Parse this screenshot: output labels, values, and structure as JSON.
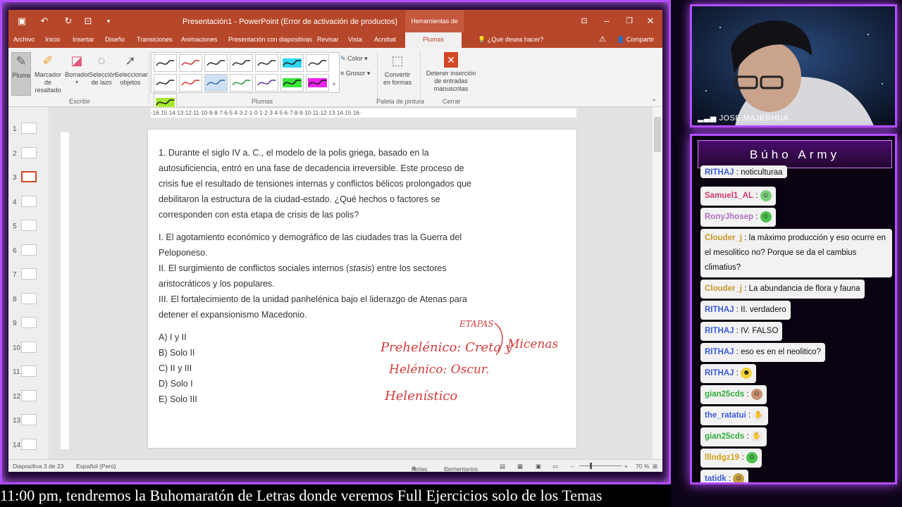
{
  "app": {
    "title": "Presentación1 - PowerPoint (Error de activación de productos)",
    "context_tab": "Herramientas de lápiz",
    "tabs": [
      "Archivo",
      "Inicio",
      "Insertar",
      "Diseño",
      "Transiciones",
      "Animaciones",
      "Presentación con diapositivas",
      "Revisar",
      "Vista",
      "Acrobat",
      "Plumas"
    ],
    "tell_me": "¿Qué desea hacer?",
    "share": "Compartir"
  },
  "ribbon": {
    "buttons": {
      "pluma": "Pluma",
      "marcador": "Marcador de resaltado",
      "borrador": "Borrador",
      "seleccion_lazo": "Selección de lazo",
      "seleccionar_objetos": "Seleccionar objetos",
      "color": "Color",
      "grosor": "Grosor",
      "convertir": "Convertir en formas",
      "detener": "Detener inserción de entradas manuscritas"
    },
    "groups": {
      "escribir": "Escribir",
      "plumas": "Plumas",
      "paleta": "Paleta de pintura",
      "cerrar": "Cerrar"
    },
    "pens": [
      {
        "color": "#333333",
        "highlight": false
      },
      {
        "color": "#d23b3b",
        "highlight": false
      },
      {
        "color": "#333333",
        "highlight": false
      },
      {
        "color": "#333333",
        "highlight": false
      },
      {
        "color": "#333333",
        "highlight": false
      },
      {
        "color": "#2fd6f0",
        "highlight": true
      },
      {
        "color": "#333333",
        "highlight": false
      },
      {
        "color": "#333333",
        "highlight": false
      },
      {
        "color": "#d23b3b",
        "highlight": false
      },
      {
        "color": "#3a6fb0",
        "highlight": false
      },
      {
        "color": "#2e9e3e",
        "highlight": false
      },
      {
        "color": "#6d3aa0",
        "highlight": false
      },
      {
        "color": "#39e639",
        "highlight": true
      },
      {
        "color": "#ee22ee",
        "highlight": true
      },
      {
        "color": "#a7e832",
        "highlight": true
      }
    ]
  },
  "thumbnails": [
    "1",
    "2",
    "3",
    "4",
    "5",
    "6",
    "7",
    "8",
    "9",
    "10",
    "11",
    "12",
    "13",
    "14"
  ],
  "ruler_text": "·16·15·14·13·12·11·10·9·8·7·6·5·4·3·2·1·0·1·2·3·4·5·6·7·8·9·10·11·12·13·14·15·16·",
  "slide": {
    "question_lines": [
      "1. Durante el siglo IV a. C., el modelo de la polis griega, basado en la",
      "autosuficiencia, entró en una fase de decadencia irreversible. Este proceso de",
      "crisis fue el resultado de tensiones internas y conflictos bélicos prolongados que",
      "debilitaron la estructura de la ciudad-estado. ¿Qué hechos o factores se",
      "corresponden con esta etapa de crisis de las polis?"
    ],
    "statements": [
      "I. El agotamiento económico y demográfico de las ciudades tras la Guerra del",
      "Peloponeso.",
      "II. El surgimiento de conflictos sociales internos (stasis) entre los sectores",
      "aristocráticos y los populares.",
      "III. El fortalecimiento de la unidad panhelénica bajo el liderazgo de Atenas para",
      "detener el expansionismo Macedonio."
    ],
    "options": [
      "A) I y II",
      "B) Solo II",
      "C) II y III",
      "D) Solo I",
      "E) Solo III"
    ],
    "ink": {
      "etapas": "ETAPAS",
      "line1": "Prehelénico: Creta y",
      "micenas": "Micenas",
      "line2": "Helénico: Oscur.",
      "line3": "Helenístico"
    }
  },
  "status": {
    "slide_count": "Diapositiva 3 de 23",
    "language": "Español (Perú)",
    "notes": "Notas",
    "comments": "Comentarios",
    "zoom": "70 %"
  },
  "webcam": {
    "name": "JOSE MAJERHUA"
  },
  "chat": {
    "title": "Búho Army",
    "messages": [
      {
        "user": "RITHAJ",
        "color": "#3b5bd9",
        "text": "noticulturaa"
      },
      {
        "user": "Samuel1_AL",
        "color": "#d23b6a",
        "text": ""
      },
      {
        "user": "RonyJhosep",
        "color": "#b06fc0",
        "text": ""
      },
      {
        "user": "Clouder_j",
        "color": "#c7962b",
        "text": "la máximo producción y eso ocurre en el mesolitico no? Porque se da el cambius climatius?"
      },
      {
        "user": "Clouder_j",
        "color": "#c7962b",
        "text": "La abundancia de flora y fauna"
      },
      {
        "user": "RITHAJ",
        "color": "#3b5bd9",
        "text": "II. verdadero"
      },
      {
        "user": "RITHAJ",
        "color": "#3b5bd9",
        "text": "IV. FALSO"
      },
      {
        "user": "RITHAJ",
        "color": "#3b5bd9",
        "text": "eso es en el neolitico?"
      },
      {
        "user": "RITHAJ",
        "color": "#3b5bd9",
        "text": ""
      },
      {
        "user": "gian25cds",
        "color": "#2eae3a",
        "text": ""
      },
      {
        "user": "the_ratatui",
        "color": "#3b5bd9",
        "text": ""
      },
      {
        "user": "gian25cds",
        "color": "#2eae3a",
        "text": ""
      },
      {
        "user": "lllndgz19",
        "color": "#d4a017",
        "text": ""
      },
      {
        "user": "tatidk",
        "color": "#3b5bd9",
        "text": ""
      }
    ]
  },
  "ticker": "11:00 pm, tendremos la Buhomaratón de Letras donde veremos Full Ejercicios solo de los Temas"
}
